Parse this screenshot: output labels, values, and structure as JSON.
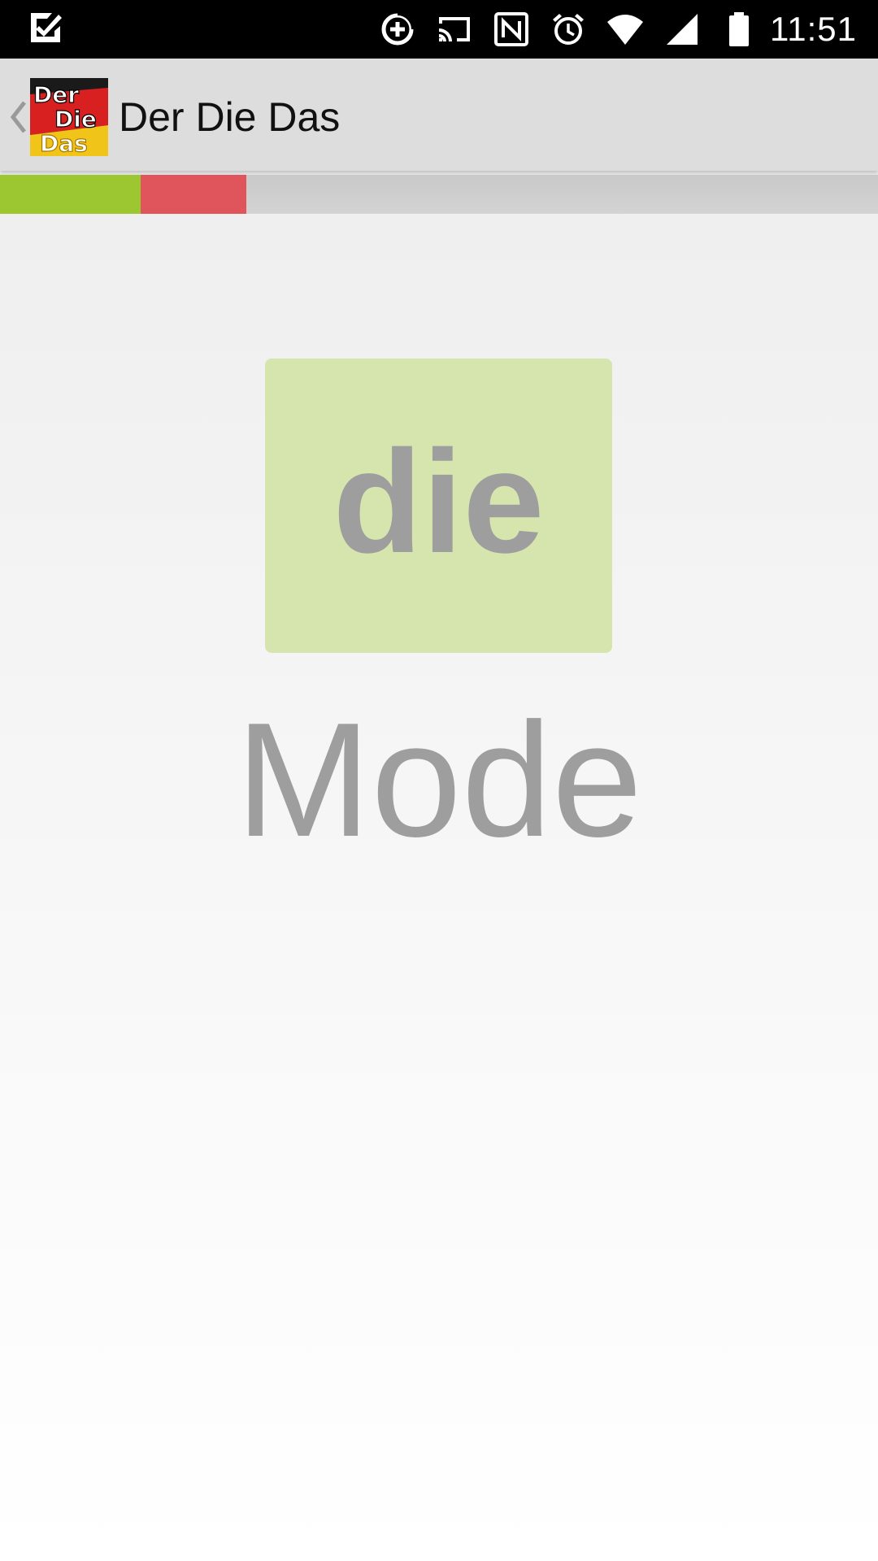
{
  "status_bar": {
    "time": "11:51",
    "icons": [
      "task-check-icon",
      "data-saver-icon",
      "cast-icon",
      "nfc-icon",
      "alarm-icon",
      "wifi-icon",
      "cell-signal-icon",
      "battery-icon"
    ]
  },
  "action_bar": {
    "title": "Der Die Das",
    "logo_text": [
      "Der",
      "Die",
      "Das"
    ]
  },
  "progress": {
    "correct_fraction": 0.16,
    "wrong_fraction": 0.12,
    "colors": {
      "correct": "#9cc731",
      "wrong": "#e0545b",
      "track": "#d0d0d0"
    }
  },
  "quiz": {
    "article": "die",
    "word": "Mode",
    "card_color": "#d6e5ad",
    "text_color": "#9e9e9e"
  }
}
